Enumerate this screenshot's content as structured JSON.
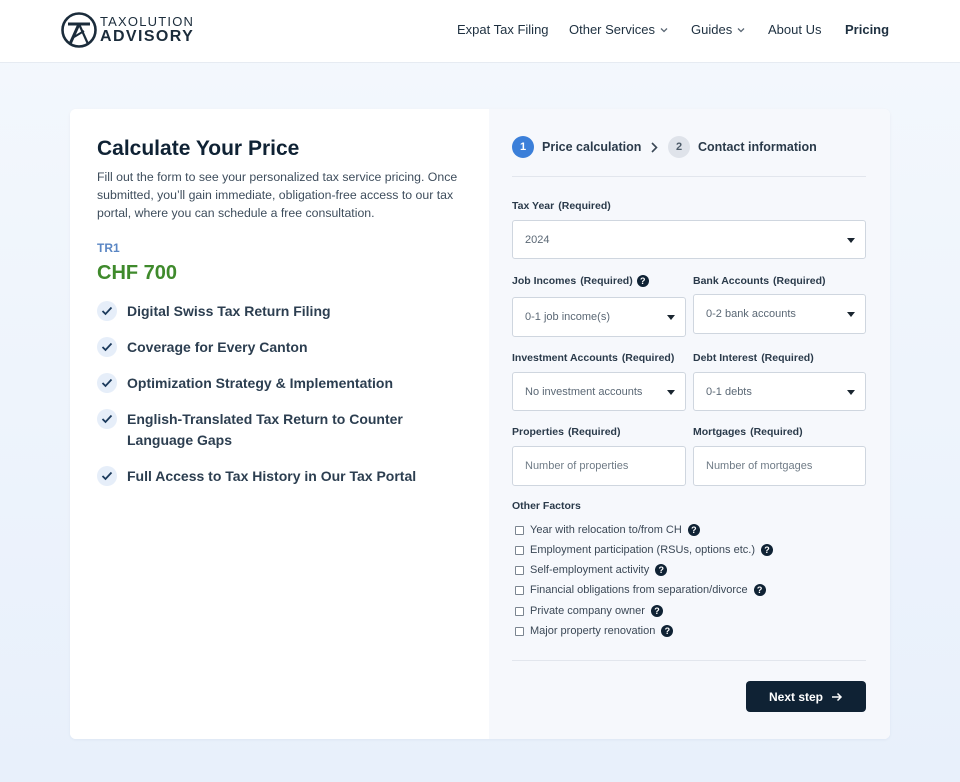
{
  "brand": {
    "top": "TAXOLUTION",
    "bottom": "ADVISORY"
  },
  "nav": [
    {
      "label": "Expat Tax Filing",
      "dropdown": false,
      "bold": false
    },
    {
      "label": "Other Services",
      "dropdown": true,
      "bold": false
    },
    {
      "label": "Guides",
      "dropdown": true,
      "bold": false
    },
    {
      "label": "About Us",
      "dropdown": false,
      "bold": false
    },
    {
      "label": "Pricing",
      "dropdown": false,
      "bold": true
    }
  ],
  "left": {
    "title": "Calculate Your Price",
    "intro": "Fill out the form to see your personalized tax service pricing. Once submitted, you’ll gain immediate, obligation-free access to our tax portal, where you can schedule a free consultation.",
    "tier": "TR1",
    "price": "CHF 700",
    "features": [
      "Digital Swiss Tax Return Filing",
      "Coverage for Every Canton",
      "Optimization Strategy & Implementation",
      "English-Translated Tax Return to Counter Language Gaps",
      "Full Access to Tax History in Our Tax Portal"
    ]
  },
  "steps": [
    {
      "num": "1",
      "label": "Price calculation",
      "active": true
    },
    {
      "num": "2",
      "label": "Contact information",
      "active": false
    }
  ],
  "form": {
    "tax_year": {
      "label": "Tax Year",
      "req": "(Required)",
      "value": "2024"
    },
    "job_incomes": {
      "label": "Job Incomes",
      "req": "(Required)",
      "value": "0-1 job income(s)"
    },
    "bank_accounts": {
      "label": "Bank Accounts",
      "req": "(Required)",
      "value": "0-2 bank accounts"
    },
    "investment_accounts": {
      "label": "Investment Accounts",
      "req": "(Required)",
      "value": "No investment accounts"
    },
    "debt_interest": {
      "label": "Debt Interest",
      "req": "(Required)",
      "value": "0-1 debts"
    },
    "properties": {
      "label": "Properties",
      "req": "(Required)",
      "placeholder": "Number of properties"
    },
    "mortgages": {
      "label": "Mortgages",
      "req": "(Required)",
      "placeholder": "Number of mortgages"
    },
    "other_factors_title": "Other Factors",
    "other_factors": [
      "Year with relocation to/from CH",
      "Employment participation (RSUs, options etc.)",
      "Self-employment activity",
      "Financial obligations from separation/divorce",
      "Private company owner",
      "Major property renovation"
    ],
    "help_glyph": "?",
    "next_label": "Next step"
  },
  "colors": {
    "accent": "#3b7fd9",
    "price": "#3f8a2c",
    "dark": "#0f2234"
  }
}
